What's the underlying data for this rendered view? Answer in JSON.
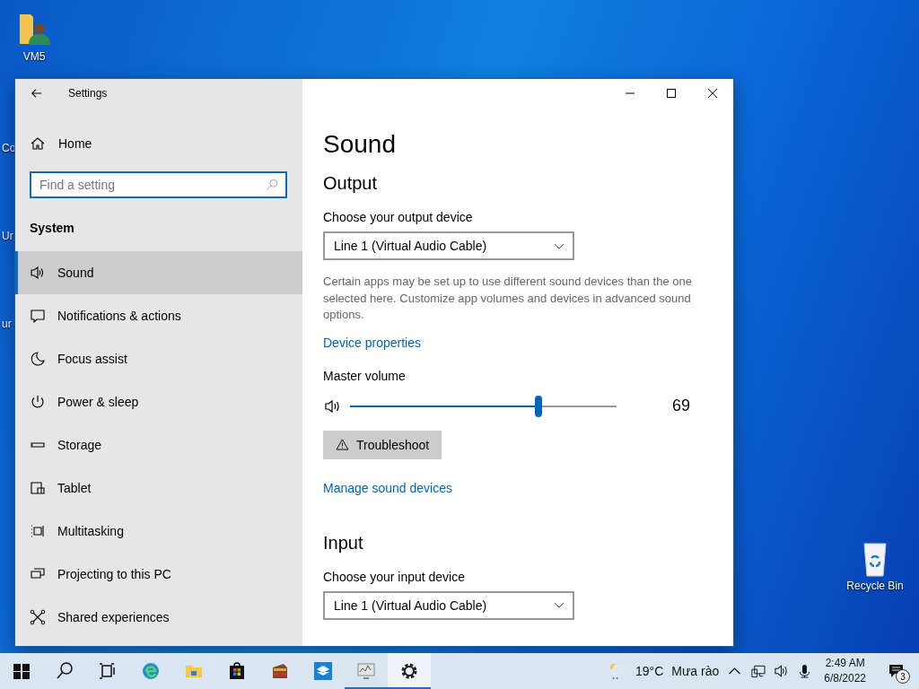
{
  "desktop": {
    "icons": [
      {
        "label": "VM5"
      },
      {
        "label": "Recycle Bin"
      }
    ],
    "cut_labels": [
      "Co",
      "Ur",
      "ur"
    ]
  },
  "window": {
    "title": "Settings",
    "sidebar": {
      "home": "Home",
      "search_placeholder": "Find a setting",
      "section": "System",
      "items": [
        {
          "label": "Sound",
          "selected": true
        },
        {
          "label": "Notifications & actions",
          "selected": false
        },
        {
          "label": "Focus assist",
          "selected": false
        },
        {
          "label": "Power & sleep",
          "selected": false
        },
        {
          "label": "Storage",
          "selected": false
        },
        {
          "label": "Tablet",
          "selected": false
        },
        {
          "label": "Multitasking",
          "selected": false
        },
        {
          "label": "Projecting to this PC",
          "selected": false
        },
        {
          "label": "Shared experiences",
          "selected": false
        }
      ]
    },
    "page": {
      "title": "Sound",
      "output": {
        "heading": "Output",
        "device_label": "Choose your output device",
        "device": "Line 1 (Virtual Audio Cable)",
        "note": "Certain apps may be set up to use different sound devices than the one selected here. Customize app volumes and devices in advanced sound options.",
        "link": "Device properties",
        "volume_label": "Master volume",
        "volume": {
          "level": 0.69,
          "reading": "69"
        },
        "troubleshoot": "Troubleshoot",
        "manage_link": "Manage sound devices"
      },
      "input": {
        "heading": "Input",
        "device_label": "Choose your input device",
        "device": "Line 1 (Virtual Audio Cable)"
      }
    }
  },
  "taskbar": {
    "apps": [
      {
        "running": false,
        "selected": false
      },
      {
        "running": false,
        "selected": false
      },
      {
        "running": false,
        "selected": false
      },
      {
        "running": false,
        "selected": false
      },
      {
        "running": false,
        "selected": false
      },
      {
        "running": true,
        "selected": false
      },
      {
        "running": true,
        "selected": true
      }
    ],
    "weather": {
      "temp": "19°C",
      "text": "Mưa rào"
    },
    "time": "2:49 AM",
    "date": "6/8/2022",
    "notifications": "3"
  }
}
